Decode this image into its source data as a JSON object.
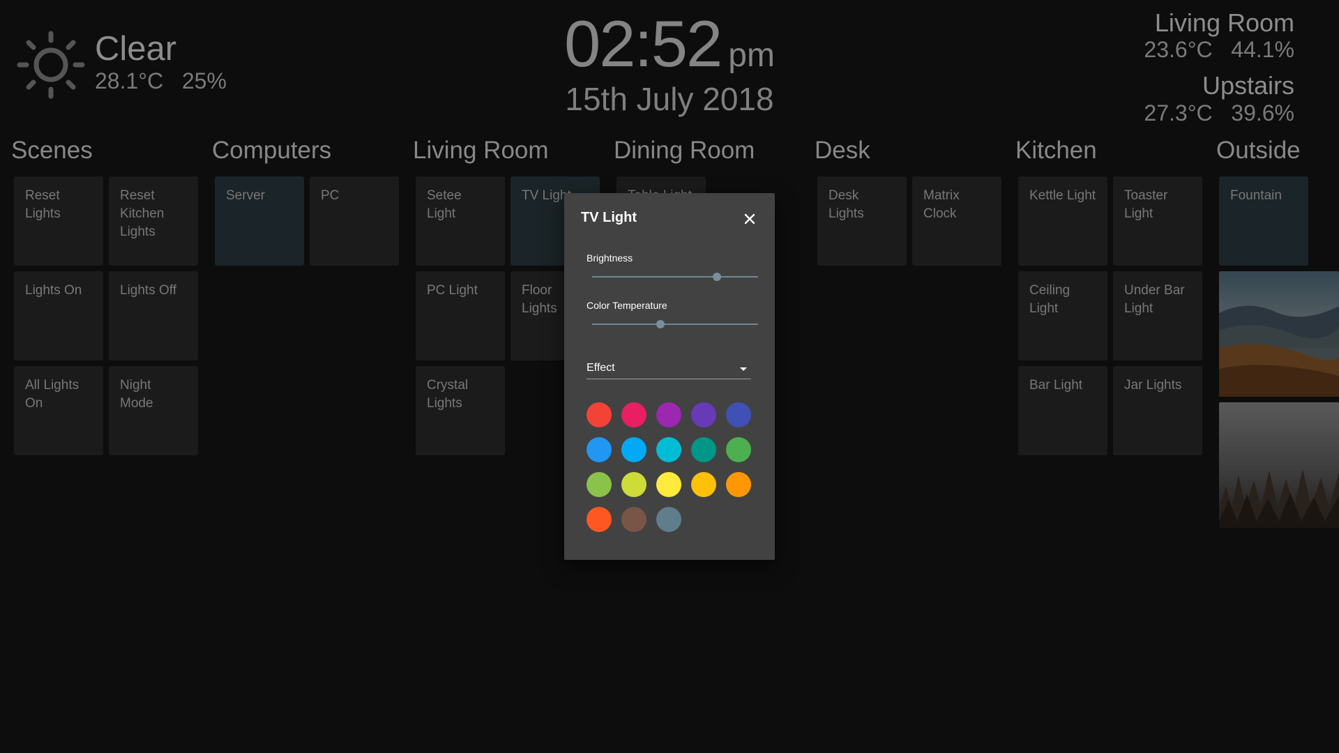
{
  "weather": {
    "icon": "sun-icon",
    "condition": "Clear",
    "values": "28.1°C   25%"
  },
  "clock": {
    "time": "02:52",
    "ampm": "pm",
    "date": "15th July 2018"
  },
  "sensors": [
    {
      "name": "Living Room",
      "values": "23.6°C   44.1%"
    },
    {
      "name": "Upstairs",
      "values": "27.3°C   39.6%"
    }
  ],
  "columns": {
    "scenes": {
      "title": "Scenes",
      "tiles": [
        "Reset Lights",
        "Reset Kitchen Lights",
        "Lights On",
        "Lights Off",
        "All Lights On",
        "Night Mode"
      ]
    },
    "computers": {
      "title": "Computers",
      "tiles": [
        "Server",
        "PC"
      ]
    },
    "living_room": {
      "title": "Living Room",
      "tiles": [
        "Setee Light",
        "TV Light",
        "PC Light",
        "Floor Lights",
        "Crystal Lights"
      ]
    },
    "dining_room": {
      "title": "Dining Room",
      "tiles": [
        "Table Light"
      ]
    },
    "desk": {
      "title": "Desk",
      "tiles": [
        "Desk Lights",
        "Matrix Clock"
      ]
    },
    "kitchen": {
      "title": "Kitchen",
      "tiles": [
        "Kettle Light",
        "Toaster Light",
        "Ceiling Light",
        "Under Bar Light",
        "Bar Light",
        "Jar Lights"
      ]
    },
    "outside": {
      "title": "Outside",
      "tiles": [
        "Fountain"
      ]
    }
  },
  "dialog": {
    "title": "TV Light",
    "close_icon": "close-icon",
    "brightness_label": "Brightness",
    "brightness_value": 0.75,
    "color_temp_label": "Color Temperature",
    "color_temp_value": 0.41,
    "effect_label": "Effect",
    "swatches": [
      "#f44336",
      "#e91e63",
      "#9c27b0",
      "#673ab7",
      "#3f51b5",
      "#2196f3",
      "#03a9f4",
      "#00bcd4",
      "#009688",
      "#4caf50",
      "#8bc34a",
      "#cddc39",
      "#ffeb3b",
      "#ffc107",
      "#ff9800",
      "#ff5722",
      "#795548",
      "#607d8b"
    ]
  },
  "colors": {
    "background": "#121212",
    "tile": "#262626",
    "tile_active": "#263238",
    "dialog": "#424242",
    "accent": "#78909c"
  }
}
